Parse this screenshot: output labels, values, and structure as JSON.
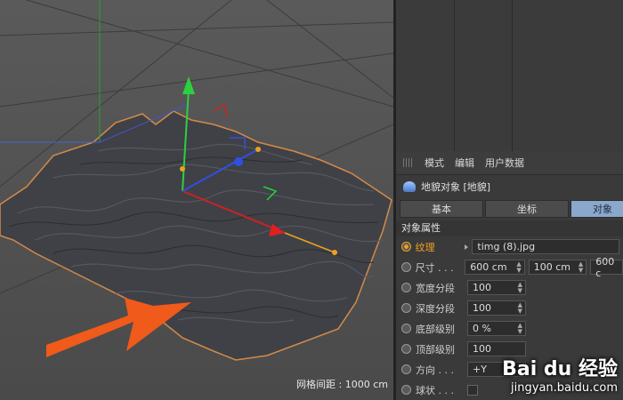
{
  "viewport": {
    "grid_label": "网格间距 : 1000 cm"
  },
  "attributes": {
    "menu": [
      "模式",
      "编辑",
      "用户数据"
    ],
    "object_title": "地貌对象 [地貌]",
    "tabs": [
      "基本",
      "坐标",
      "对象"
    ],
    "section": "对象属性",
    "rows": {
      "texture": {
        "label": "纹理",
        "value": "timg (8).jpg"
      },
      "size": {
        "label": "尺寸 . . .",
        "x": "600 cm",
        "y": "100 cm",
        "z": "600 c"
      },
      "width_seg": {
        "label": "宽度分段",
        "value": "100"
      },
      "depth_seg": {
        "label": "深度分段",
        "value": "100"
      },
      "bottom_level": {
        "label": "底部级别",
        "value": "0 %"
      },
      "top_level": {
        "label": "顶部级别",
        "value": "100"
      },
      "direction": {
        "label": "方向 . . .",
        "value": "+Y"
      },
      "spherical": {
        "label": "球状 . . ."
      }
    }
  },
  "watermark": {
    "main": "Bai du 经验",
    "sub": "jingyan.baidu.com"
  },
  "colors": {
    "accent": "#f0a020",
    "tab_active": "#8aa7cc",
    "arrow": "#f05a1a"
  }
}
